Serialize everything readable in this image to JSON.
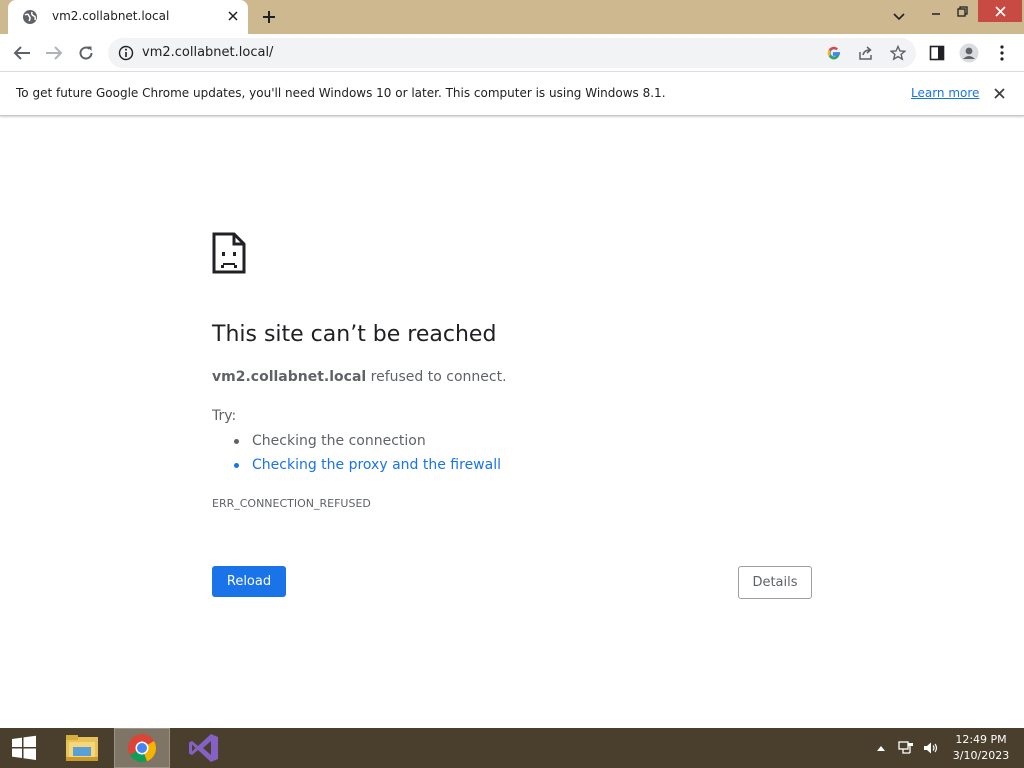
{
  "browser": {
    "tab": {
      "title": "vm2.collabnet.local"
    },
    "url": "vm2.collabnet.local/"
  },
  "infobar": {
    "message": "To get future Google Chrome updates, you'll need Windows 10 or later. This computer is using Windows 8.1.",
    "link_label": "Learn more"
  },
  "error": {
    "title": "This site can’t be reached",
    "host": "vm2.collabnet.local",
    "reason": " refused to connect.",
    "try_label": "Try:",
    "suggestions": [
      "Checking the connection",
      "Checking the proxy and the firewall"
    ],
    "code": "ERR_CONNECTION_REFUSED",
    "reload_label": "Reload",
    "details_label": "Details"
  },
  "taskbar": {
    "time": "12:49 PM",
    "date": "3/10/2023",
    "apps": [
      "file-explorer",
      "chrome",
      "visual-studio"
    ]
  },
  "colors": {
    "titlebar": "#cdb88f",
    "taskbar": "#4a3f2c",
    "accent": "#1a73e8",
    "close_button": "#c74b43"
  }
}
